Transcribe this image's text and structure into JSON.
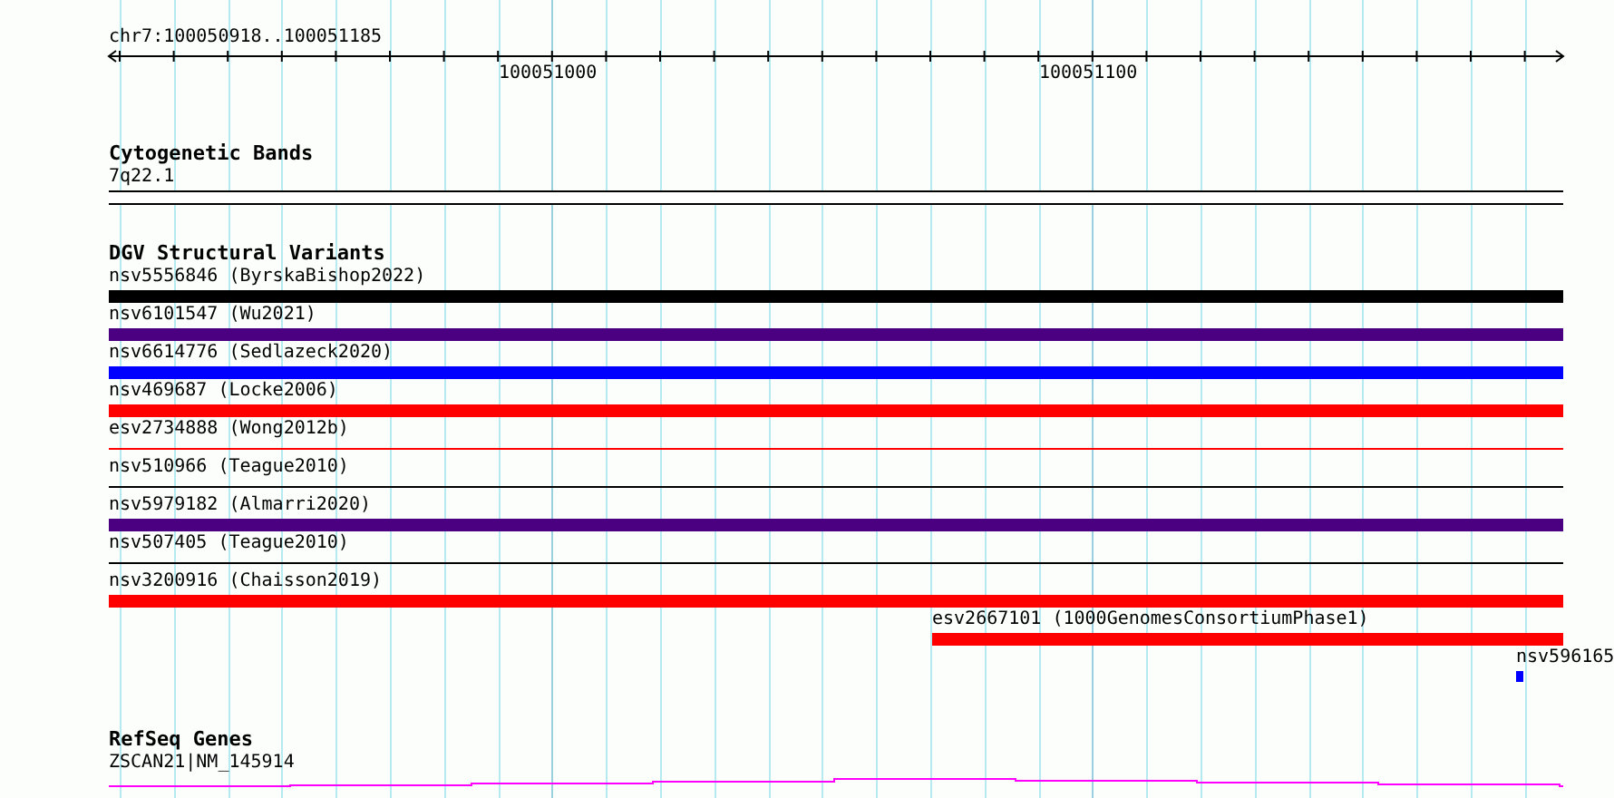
{
  "ruler": {
    "range": "chr7:100050918..100051185",
    "ticks": [
      "100051000",
      "100051100"
    ]
  },
  "tracks": [
    {
      "title": "Cytogenetic Bands",
      "kind": "band",
      "features": [
        {
          "label": "7q22.1",
          "kind": "band",
          "color": "#000000"
        }
      ]
    },
    {
      "title": "DGV Structural Variants",
      "kind": "variants",
      "features": [
        {
          "label": "nsv5556846 (ByrskaBishop2022)",
          "kind": "bar",
          "color": "#000000"
        },
        {
          "label": "nsv6101547 (Wu2021)",
          "kind": "bar",
          "color": "#4b0082"
        },
        {
          "label": "nsv6614776 (Sedlazeck2020)",
          "kind": "bar",
          "color": "#0000ff"
        },
        {
          "label": "nsv469687 (Locke2006)",
          "kind": "bar",
          "color": "#ff0000"
        },
        {
          "label": "esv2734888 (Wong2012b)",
          "kind": "line",
          "color": "#ff0000"
        },
        {
          "label": "nsv510966 (Teague2010)",
          "kind": "line",
          "color": "#000000"
        },
        {
          "label": "nsv5979182 (Almarri2020)",
          "kind": "bar",
          "color": "#4b0082"
        },
        {
          "label": "nsv507405 (Teague2010)",
          "kind": "line",
          "color": "#000000"
        },
        {
          "label": "nsv3200916 (Chaisson2019)",
          "kind": "bar",
          "color": "#ff0000"
        },
        {
          "label": "esv2667101 (1000GenomesConsortiumPhase1)",
          "kind": "partial",
          "color": "#ff0000"
        },
        {
          "label": "nsv596165",
          "kind": "point",
          "color": "#0000ff"
        }
      ]
    },
    {
      "title": "RefSeq Genes",
      "kind": "genes",
      "features": [
        {
          "label": "ZSCAN21|NM_145914",
          "kind": "gene",
          "color": "#ff00ff"
        }
      ]
    }
  ]
}
